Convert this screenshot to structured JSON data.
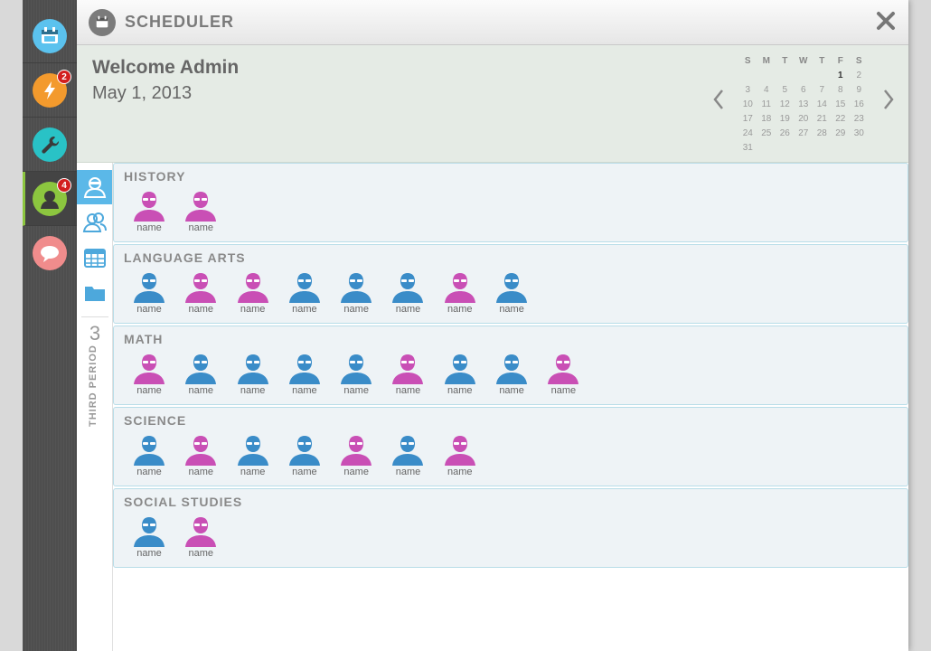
{
  "rail": {
    "items": [
      {
        "icon": "calendar-icon",
        "color": "#5bc2ee",
        "badge": ""
      },
      {
        "icon": "lightning-icon",
        "color": "#f39a2d",
        "badge": "2"
      },
      {
        "icon": "wrench-icon",
        "color": "#29c2c6",
        "badge": ""
      },
      {
        "icon": "user-icon",
        "color": "#8cc63f",
        "badge": "4"
      },
      {
        "icon": "chat-icon",
        "color": "#f08c8c",
        "badge": ""
      }
    ]
  },
  "window": {
    "title": "SCHEDULER",
    "close_icon": "close-icon"
  },
  "header": {
    "welcome": "Welcome Admin",
    "date": "May 1, 2013"
  },
  "calendar": {
    "day_headers": [
      "S",
      "M",
      "T",
      "W",
      "T",
      "F",
      "S"
    ],
    "weeks": [
      [
        "",
        "",
        "",
        "",
        "",
        "1",
        "2"
      ],
      [
        "3",
        "4",
        "5",
        "6",
        "7",
        "8",
        "9"
      ],
      [
        "10",
        "11",
        "12",
        "13",
        "14",
        "15",
        "16"
      ],
      [
        "17",
        "18",
        "19",
        "20",
        "21",
        "22",
        "23"
      ],
      [
        "24",
        "25",
        "26",
        "27",
        "28",
        "29",
        "30"
      ],
      [
        "31",
        "",
        "",
        "",
        "",
        "",
        ""
      ]
    ],
    "today": "1"
  },
  "tabs": [
    {
      "icon": "students-icon",
      "active": true
    },
    {
      "icon": "group-icon",
      "active": false
    },
    {
      "icon": "calendar-grid-icon",
      "active": false
    },
    {
      "icon": "folder-icon",
      "active": false
    }
  ],
  "period": {
    "number": "3",
    "label": "THIRD PERIOD"
  },
  "colors": {
    "female": "#c94fb5",
    "male": "#3a8cc8"
  },
  "groups": [
    {
      "title": "HISTORY",
      "students": [
        {
          "name": "name",
          "gender": "female"
        },
        {
          "name": "name",
          "gender": "female"
        }
      ]
    },
    {
      "title": "LANGUAGE ARTS",
      "students": [
        {
          "name": "name",
          "gender": "male"
        },
        {
          "name": "name",
          "gender": "female"
        },
        {
          "name": "name",
          "gender": "female"
        },
        {
          "name": "name",
          "gender": "male"
        },
        {
          "name": "name",
          "gender": "male"
        },
        {
          "name": "name",
          "gender": "male"
        },
        {
          "name": "name",
          "gender": "female"
        },
        {
          "name": "name",
          "gender": "male"
        }
      ]
    },
    {
      "title": "MATH",
      "students": [
        {
          "name": "name",
          "gender": "female"
        },
        {
          "name": "name",
          "gender": "male"
        },
        {
          "name": "name",
          "gender": "male"
        },
        {
          "name": "name",
          "gender": "male"
        },
        {
          "name": "name",
          "gender": "male"
        },
        {
          "name": "name",
          "gender": "female"
        },
        {
          "name": "name",
          "gender": "male"
        },
        {
          "name": "name",
          "gender": "male"
        },
        {
          "name": "name",
          "gender": "female"
        }
      ]
    },
    {
      "title": "SCIENCE",
      "students": [
        {
          "name": "name",
          "gender": "male"
        },
        {
          "name": "name",
          "gender": "female"
        },
        {
          "name": "name",
          "gender": "male"
        },
        {
          "name": "name",
          "gender": "male"
        },
        {
          "name": "name",
          "gender": "female"
        },
        {
          "name": "name",
          "gender": "male"
        },
        {
          "name": "name",
          "gender": "female"
        }
      ]
    },
    {
      "title": "SOCIAL STUDIES",
      "students": [
        {
          "name": "name",
          "gender": "male"
        },
        {
          "name": "name",
          "gender": "female"
        }
      ]
    }
  ]
}
